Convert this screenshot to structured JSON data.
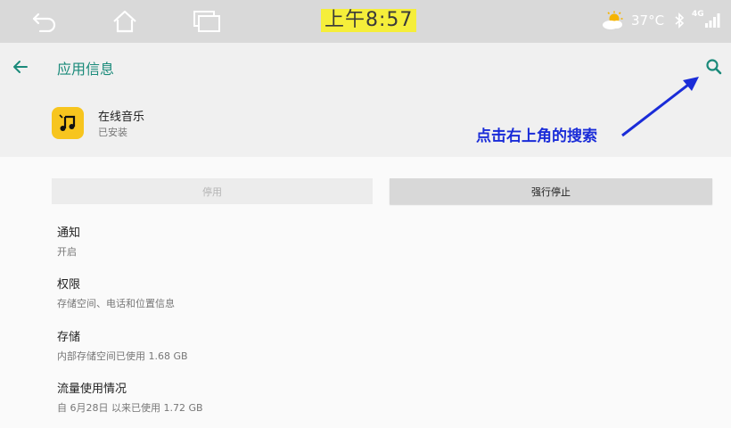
{
  "status_bar": {
    "time": "上午8:57",
    "temperature": "37°C",
    "network": "4G",
    "icons": [
      "back-icon",
      "home-icon",
      "recent-apps-icon",
      "weather-sun-cloud-icon",
      "bluetooth-icon",
      "signal-icon"
    ]
  },
  "header": {
    "title": "应用信息",
    "back_icon": "arrow-left-icon",
    "search_icon": "search-icon",
    "accent_color": "#1a8a7a"
  },
  "app": {
    "name": "在线音乐",
    "status": "已安装",
    "icon": "music-note-icon",
    "icon_color": "#f7c51e"
  },
  "annotation": {
    "text": "点击右上角的搜索",
    "color": "#1a2cd8"
  },
  "buttons": {
    "disable_label": "停用",
    "force_stop_label": "强行停止"
  },
  "settings": [
    {
      "title": "通知",
      "subtitle": "开启"
    },
    {
      "title": "权限",
      "subtitle": "存储空间、电话和位置信息"
    },
    {
      "title": "存储",
      "subtitle": "内部存储空间已使用 1.68 GB"
    },
    {
      "title": "流量使用情况",
      "subtitle": "自 6月28日 以来已使用 1.72 GB"
    }
  ]
}
